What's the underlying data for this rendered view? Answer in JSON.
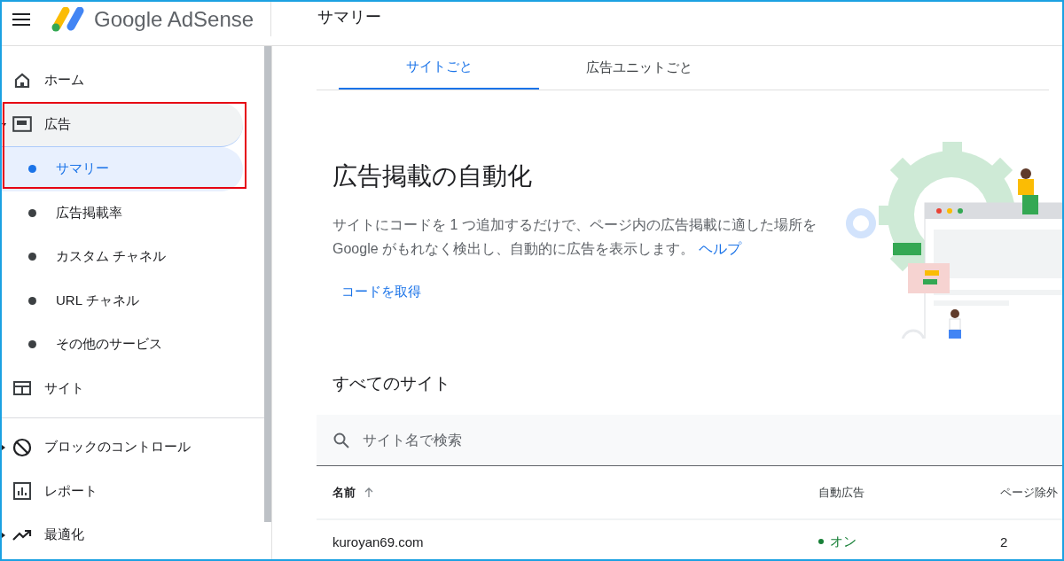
{
  "header": {
    "product": "Google AdSense",
    "page_title": "サマリー"
  },
  "sidebar": {
    "items": [
      {
        "label": "ホーム",
        "selected": false
      },
      {
        "label": "広告",
        "selected": false,
        "expanded": true,
        "children": [
          {
            "label": "サマリー",
            "selected": true
          },
          {
            "label": "広告掲載率",
            "selected": false
          },
          {
            "label": "カスタム チャネル",
            "selected": false
          },
          {
            "label": "URL チャネル",
            "selected": false
          },
          {
            "label": "その他のサービス",
            "selected": false
          }
        ]
      },
      {
        "label": "サイト",
        "selected": false
      },
      {
        "label": "ブロックのコントロール",
        "selected": false,
        "expanded": false
      },
      {
        "label": "レポート",
        "selected": false
      },
      {
        "label": "最適化",
        "selected": false,
        "expanded": false
      }
    ]
  },
  "tabs": [
    {
      "label": "サイトごと",
      "selected": true
    },
    {
      "label": "広告ユニットごと",
      "selected": false
    }
  ],
  "hero": {
    "title": "広告掲載の自動化",
    "text": "サイトにコードを 1 つ追加するだけで、ページ内の広告掲載に適した場所を Google がもれなく検出し、自動的に広告を表示します。",
    "help_link": "ヘルプ",
    "action": "コードを取得"
  },
  "sites": {
    "title": "すべてのサイト",
    "search": {
      "placeholder": "サイト名で検索"
    },
    "columns": [
      "名前",
      "自動広告",
      "ページ除外"
    ],
    "rows": [
      {
        "name": "kuroyan69.com",
        "auto_ads": "オン",
        "auto_ads_on": true,
        "exclusions": "2"
      }
    ]
  }
}
